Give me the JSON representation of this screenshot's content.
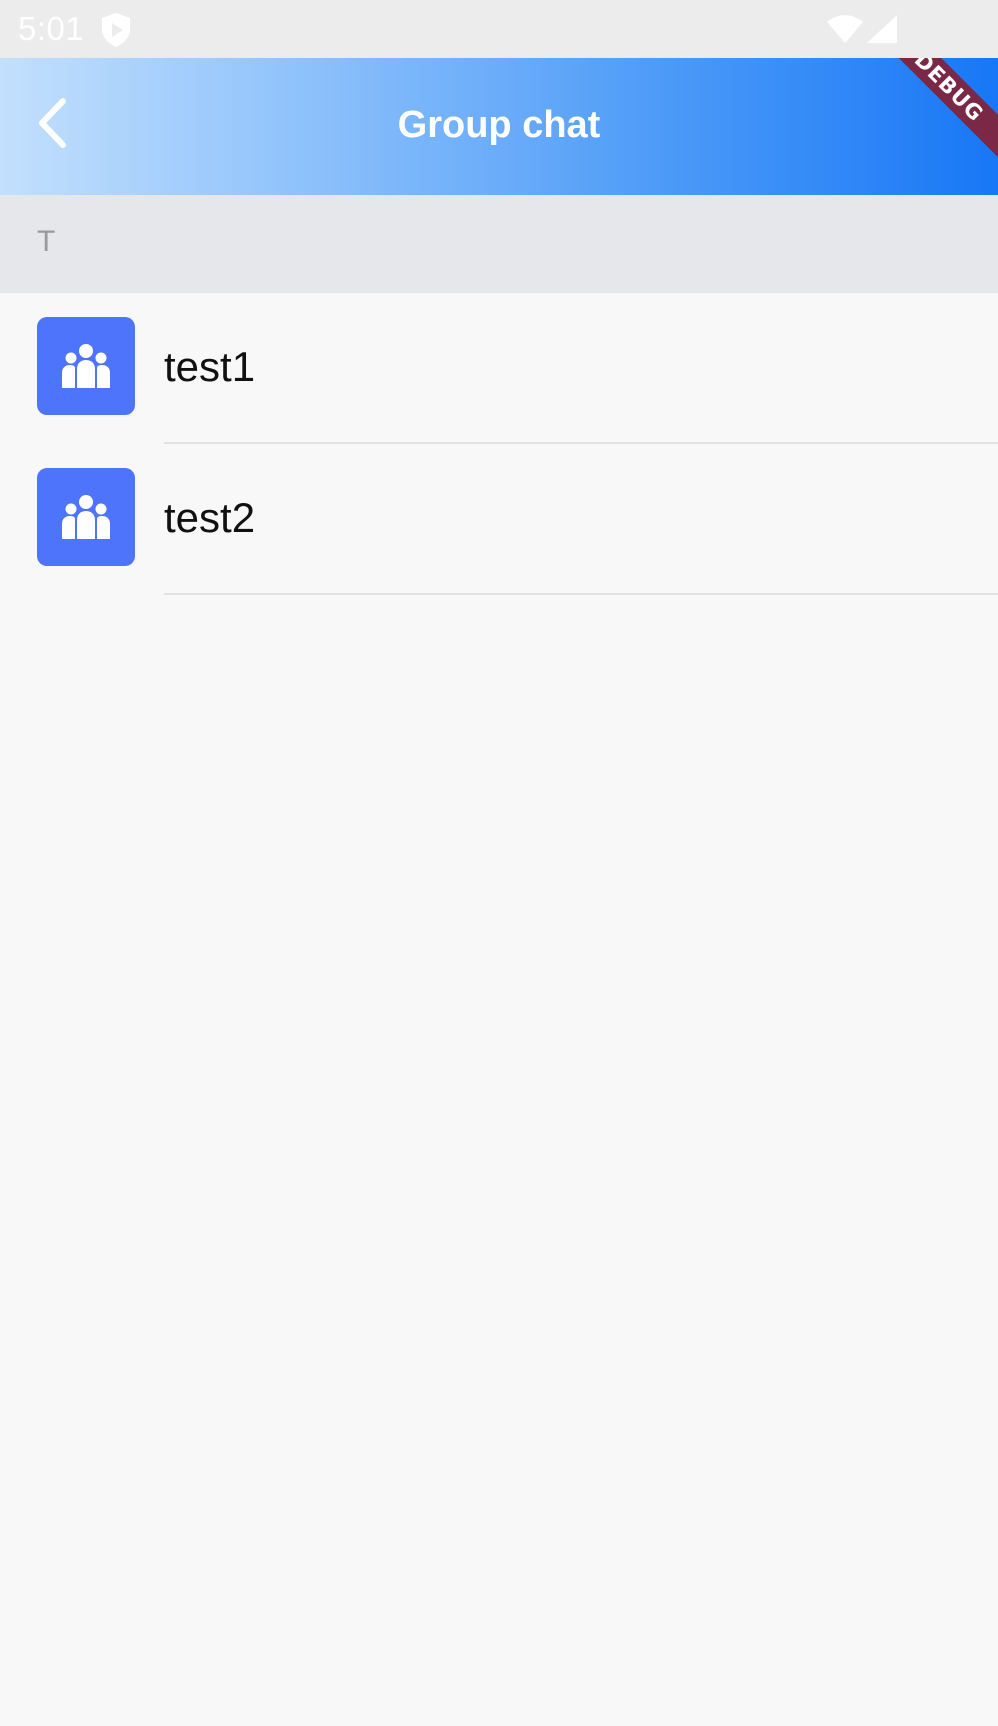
{
  "status_bar": {
    "time": "5:01",
    "icons": [
      "shield-play-icon",
      "wifi-icon",
      "signal-icon"
    ]
  },
  "app_bar": {
    "title": "Group chat",
    "back_icon": "chevron-left-icon",
    "debug_banner": "DEBUG",
    "gradient": [
      "#c3e0fd",
      "#1877f6"
    ]
  },
  "section": {
    "letter": "T"
  },
  "groups": [
    {
      "name": "test1",
      "icon": "group-icon"
    },
    {
      "name": "test2",
      "icon": "group-icon"
    }
  ],
  "colors": {
    "avatar_bg": "#4e74fb",
    "section_bg": "#e6e7ea",
    "page_bg": "#f8f8f9",
    "debug_banner": "#7a2845"
  }
}
